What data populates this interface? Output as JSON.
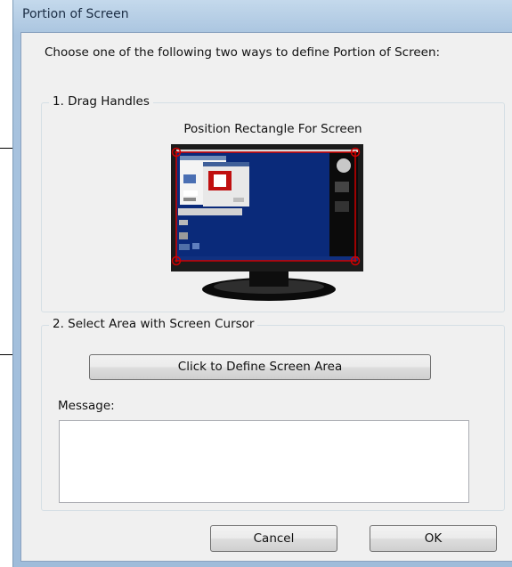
{
  "window": {
    "title": "Portion of Screen"
  },
  "instructions": "Choose one of the following two ways to define Portion of Screen:",
  "drag_handles_group": {
    "legend": "1. Drag Handles",
    "preview_title": "Position Rectangle For Screen"
  },
  "select_area_group": {
    "legend": "2. Select Area with Screen Cursor",
    "define_button": "Click to Define Screen Area",
    "message_label": "Message:",
    "message_value": ""
  },
  "footer": {
    "cancel": "Cancel",
    "ok": "OK"
  },
  "colors": {
    "handle_red": "#d00000",
    "desktop_blue": "#0a2a7a",
    "monitor_bezel": "#1b1b1b"
  }
}
